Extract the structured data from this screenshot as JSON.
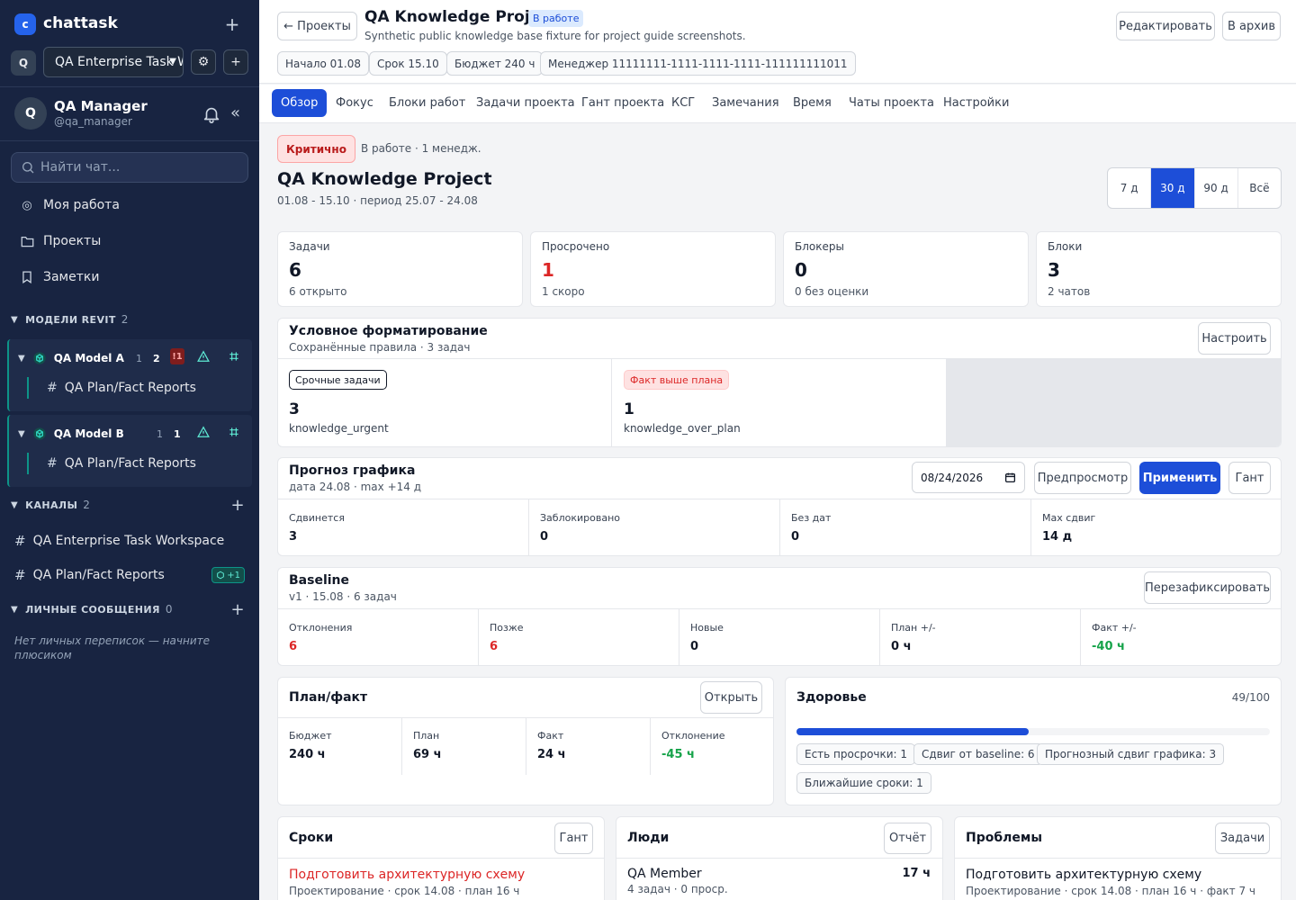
{
  "sidebar": {
    "logo_letter": "c",
    "brand": "chattask",
    "workspace": {
      "badge": "Q",
      "name": "QA Enterprise Task Workspace"
    },
    "user": {
      "avatar": "Q",
      "name": "QA Manager",
      "handle": "@qa_manager"
    },
    "search_placeholder": "Найти чат...",
    "nav": [
      {
        "icon": "target-icon",
        "label": "Моя работа"
      },
      {
        "icon": "folder-icon",
        "label": "Проекты"
      },
      {
        "icon": "bookmark-icon",
        "label": "Заметки"
      }
    ],
    "revit_section": {
      "label": "МОДЕЛИ REVIT",
      "count": "2"
    },
    "models": [
      {
        "name": "QA Model A",
        "count1": "1",
        "count2": "2",
        "alert": "!1",
        "channel": "QA Plan/Fact Reports"
      },
      {
        "name": "QA Model B",
        "count1": "1",
        "count2": "1",
        "alert": "",
        "channel": "QA Plan/Fact Reports"
      }
    ],
    "channels_section": {
      "label": "КАНАЛЫ",
      "count": "2"
    },
    "channels": [
      {
        "name": "QA Enterprise Task Workspace",
        "badge": ""
      },
      {
        "name": "QA Plan/Fact Reports",
        "badge": "+1"
      }
    ],
    "dm_section": {
      "label": "ЛИЧНЫЕ СООБЩЕНИЯ",
      "count": "0"
    },
    "dm_empty": "Нет личных переписок — начните плюсиком"
  },
  "header": {
    "back": "← Проекты",
    "title": "QA Knowledge Project",
    "status": "В работе",
    "description": "Synthetic public knowledge base fixture for project guide screenshots.",
    "chips": [
      "Начало 01.08",
      "Срок 15.10",
      "Бюджет 240 ч",
      "Менеджер 11111111-1111-1111-1111-111111111011"
    ],
    "edit": "Редактировать",
    "archive": "В архив"
  },
  "tabs": [
    "Обзор",
    "Фокус",
    "Блоки работ",
    "Задачи проекта",
    "Гант проекта",
    "КСГ",
    "Замечания",
    "Время",
    "Чаты проекта",
    "Настройки"
  ],
  "active_tab": "Обзор",
  "overview": {
    "priority": "Критично",
    "meta": "В работе · 1 менедж.",
    "title": "QA Knowledge Project",
    "dates": "01.08 - 15.10 · период 25.07 - 24.08",
    "periods": [
      "7 д",
      "30 д",
      "90 д",
      "Всё"
    ],
    "active_period": "30 д"
  },
  "kpis": [
    {
      "label": "Задачи",
      "value": "6",
      "sub": "6 открыто"
    },
    {
      "label": "Просрочено",
      "value": "1",
      "sub": "1 скоро"
    },
    {
      "label": "Блокеры",
      "value": "0",
      "sub": "0 без оценки"
    },
    {
      "label": "Блоки",
      "value": "3",
      "sub": "2 чатов"
    }
  ],
  "conditional": {
    "title": "Условное форматирование",
    "subtitle": "Сохранённые правила · 3 задач",
    "configure": "Настроить",
    "rules": [
      {
        "tag": "Срочные задачи",
        "value": "3",
        "key": "knowledge_urgent"
      },
      {
        "tag": "Факт выше плана",
        "value": "1",
        "key": "knowledge_over_plan"
      }
    ]
  },
  "forecast": {
    "title": "Прогноз графика",
    "subtitle": "дата 24.08 · max +14 д",
    "date_value": "08/24/2026",
    "preview": "Предпросмотр",
    "apply": "Применить",
    "gantt": "Гант",
    "cells": [
      {
        "label": "Сдвинется",
        "value": "3"
      },
      {
        "label": "Заблокировано",
        "value": "0"
      },
      {
        "label": "Без дат",
        "value": "0"
      },
      {
        "label": "Max сдвиг",
        "value": "14 д"
      }
    ]
  },
  "baseline": {
    "title": "Baseline",
    "subtitle": "v1 · 15.08 · 6 задач",
    "refix": "Перезафиксировать",
    "cells": [
      {
        "label": "Отклонения",
        "value": "6",
        "tone": "red"
      },
      {
        "label": "Позже",
        "value": "6",
        "tone": "red"
      },
      {
        "label": "Новые",
        "value": "0",
        "tone": ""
      },
      {
        "label": "План +/-",
        "value": "0 ч",
        "tone": ""
      },
      {
        "label": "Факт +/-",
        "value": "-40 ч",
        "tone": "green"
      }
    ]
  },
  "planfact": {
    "title": "План/факт",
    "open": "Открыть",
    "cells": [
      {
        "label": "Бюджет",
        "value": "240 ч",
        "tone": ""
      },
      {
        "label": "План",
        "value": "69 ч",
        "tone": ""
      },
      {
        "label": "Факт",
        "value": "24 ч",
        "tone": ""
      },
      {
        "label": "Отклонение",
        "value": "-45 ч",
        "tone": "green"
      }
    ]
  },
  "health": {
    "title": "Здоровье",
    "score": "49/100",
    "progress": 0.49,
    "tags": [
      "Есть просрочки: 1",
      "Сдвиг от baseline: 6",
      "Прогнозный сдвиг графика: 3",
      "Ближайшие сроки: 1"
    ]
  },
  "deadlines": {
    "title": "Сроки",
    "action": "Гант",
    "item_title": "Подготовить архитектурную схему",
    "item_meta": "Проектирование · срок 14.08 · план 16 ч"
  },
  "people": {
    "title": "Люди",
    "action": "Отчёт",
    "name": "QA Member",
    "hours": "17 ч",
    "meta": "4 задач · 0 проср."
  },
  "problems": {
    "title": "Проблемы",
    "action": "Задачи",
    "item_title": "Подготовить архитектурную схему",
    "item_meta": "Проектирование · срок 14.08 · план 16 ч · факт 7 ч"
  },
  "colors": {
    "sidebar": "#182441",
    "accent": "#1d4ed8",
    "danger": "#dc2626",
    "success": "#16a34a",
    "teal": "#0d9488"
  }
}
